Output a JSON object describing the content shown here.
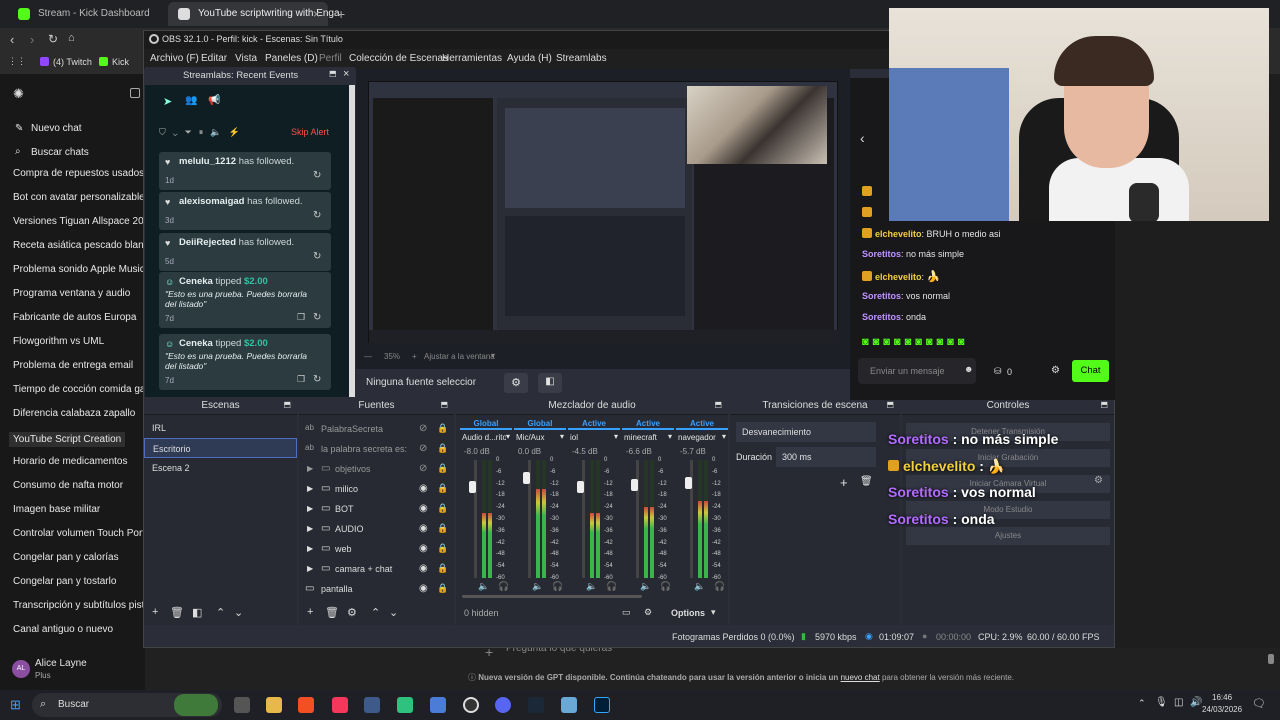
{
  "browser": {
    "tabs": [
      {
        "label": "Stream - Kick Dashboard"
      },
      {
        "label": "YouTube scriptwriting with Enga"
      }
    ],
    "bookmarks": [
      "(4) Twitch",
      "Kick"
    ]
  },
  "gpt": {
    "new_chat": "Nuevo chat",
    "search": "Buscar chats",
    "history": [
      "Compra de repuestos usados",
      "Bot con avatar personalizable",
      "Versiones Tiguan Allspace 2019",
      "Receta asiática pescado blanco",
      "Problema sonido Apple Music",
      "Programa ventana y audio",
      "Fabricante de autos Europa",
      "Flowgorithm vs UML",
      "Problema de entrega email",
      "Tiempo de cocción comida gato",
      "Diferencia calabaza zapallo",
      "YouTube Script Creation",
      "Horario de medicamentos",
      "Consumo de nafta motor",
      "Imagen base militar",
      "Controlar volumen Touch Portal",
      "Congelar pan y calorías",
      "Congelar pan y tostarlo",
      "Transcripción y subtítulos pista",
      "Canal antiguo o nuevo"
    ],
    "user_name": "Alice Layne",
    "user_plan": "Plus",
    "user_initials": "AL",
    "prompt_placeholder": "Pregunta lo que quieras",
    "notice": "Nueva versión de GPT disponible. Continúa chateando para usar la versión anterior o inicia un",
    "notice_link": "nuevo chat",
    "notice_tail": "para obtener la versión más reciente."
  },
  "obs": {
    "title": "OBS 32.1.0 - Perfil: kick - Escenas: Sin Título",
    "menu": [
      "Archivo (F)",
      "Editar",
      "Vista",
      "Paneles (D)",
      "Perfil",
      "Colección de Escenas",
      "Herramientas",
      "Ayuda (H)",
      "Streamlabs"
    ],
    "no_source": "Ninguna fuente seleccionada",
    "zoom": "35%",
    "fit": "Ajustar a la ventana",
    "scenes_title": "Escenas",
    "scenes": [
      "IRL",
      "Escritorio",
      "Escena 2"
    ],
    "sources_title": "Fuentes",
    "sources": [
      "PalabraSecreta",
      "la palabra secreta es:",
      "objetivos",
      "milico",
      "BOT",
      "AUDIO",
      "web",
      "camara + chat",
      "pantalla"
    ],
    "mixer_title": "Mezclador de audio",
    "mixer": [
      {
        "tag": "Global",
        "name": "Audio d...ritorio",
        "db": "-8.0 dB",
        "level": 0.55
      },
      {
        "tag": "Global",
        "name": "Mic/Aux",
        "db": "0.0 dB",
        "level": 0.75
      },
      {
        "tag": "Active",
        "name": "iol",
        "db": "-4.5 dB",
        "level": 0.55
      },
      {
        "tag": "Active",
        "name": "minecraft",
        "db": "-6.6 dB",
        "level": 0.6
      },
      {
        "tag": "Active",
        "name": "navegador",
        "db": "-5.7 dB",
        "level": 0.65
      }
    ],
    "mixer_ticks": [
      "0",
      "-6",
      "-12",
      "-18",
      "-24",
      "-30",
      "-36",
      "-42",
      "-48",
      "-54",
      "-60"
    ],
    "hidden": "0 hidden",
    "options": "Options",
    "trans_title": "Transiciones de escena",
    "transition": "Desvanecimiento",
    "duration_label": "Duración",
    "duration": "300 ms",
    "controls_title": "Controles",
    "controls": [
      "Detener Transmisión",
      "Iniciar Grabación",
      "Iniciar Cámara Virtual",
      "Modo Estudio",
      "Ajustes"
    ],
    "status": {
      "dropped": "Fotogramas Perdidos 0 (0.0%)",
      "kbps": "5970 kbps",
      "live": "01:09:07",
      "rec": "00:00:00",
      "cpu": "CPU: 2.9%",
      "fps": "60.00 / 60.00 FPS"
    }
  },
  "streamlabs": {
    "title": "Streamlabs: Recent Events",
    "skip": "Skip Alert",
    "events": [
      {
        "user": "melulu_1212",
        "text": "has followed.",
        "age": "1d"
      },
      {
        "user": "alexisomaigad",
        "text": "has followed.",
        "age": "3d"
      },
      {
        "user": "DeiiRejected",
        "text": "has followed.",
        "age": "5d"
      },
      {
        "user": "Ceneka",
        "text": "tipped",
        "amount": "$2.00",
        "msg": "\"Esto es una prueba. Puedes borrarla del listado\"",
        "age": "7d"
      },
      {
        "user": "Ceneka",
        "text": "tipped",
        "amount": "$2.00",
        "msg": "\"Esto es una prueba. Puedes borrarla del listado\"",
        "age": "7d"
      }
    ]
  },
  "chat": {
    "lines": [
      {
        "user": "elchevelito",
        "msg": ": BRUH o medio asi"
      },
      {
        "user": "Soretitos",
        "msg": ": no más simple"
      },
      {
        "user": "elchevelito",
        "msg": ": "
      },
      {
        "user": "Soretitos",
        "msg": ": vos normal"
      },
      {
        "user": "Soretitos",
        "msg": ": onda"
      }
    ],
    "placeholder": "Enviar un mensaje",
    "points": "0",
    "send": "Chat"
  },
  "overlay": [
    {
      "user": "Soretitos",
      "msg": " : no más simple"
    },
    {
      "user": "elchevelito",
      "msg": " : "
    },
    {
      "user": "Soretitos",
      "msg": " : vos normal"
    },
    {
      "user": "Soretitos",
      "msg": " : onda"
    }
  ],
  "taskbar": {
    "search": "Buscar",
    "time": "16:46",
    "date": "24/03/2026"
  },
  "colors": {
    "kick_green": "#53fc18",
    "twitch_purple": "#bf94ff",
    "obs_active": "#3aa0ff"
  }
}
